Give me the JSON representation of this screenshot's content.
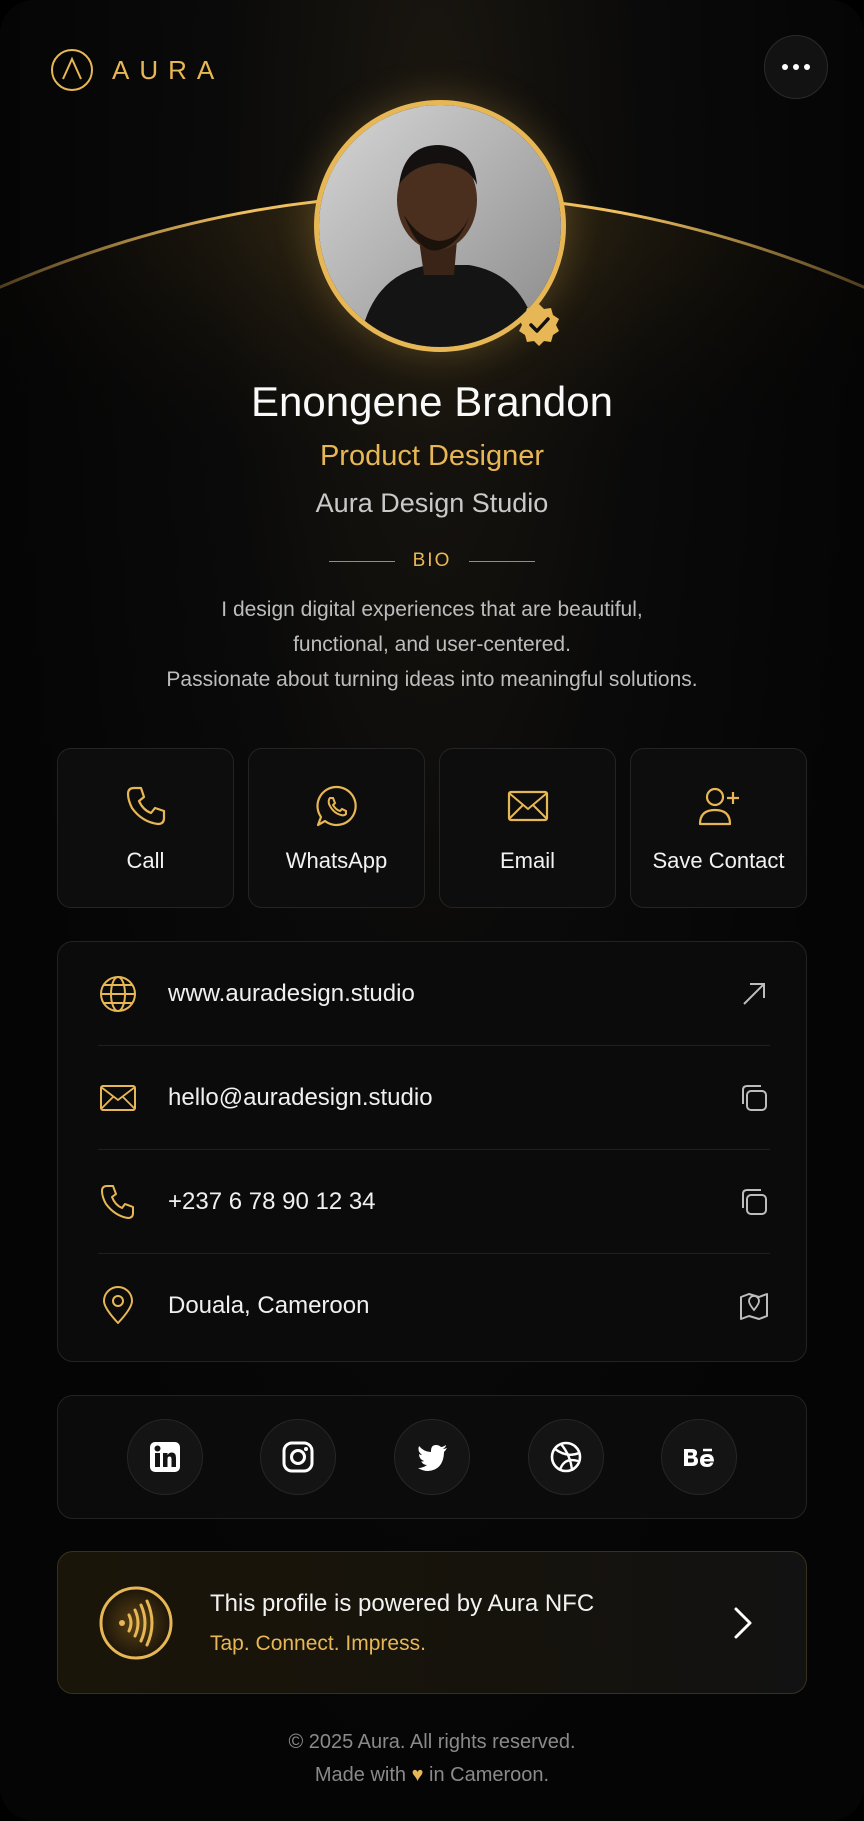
{
  "brand": {
    "name": "AURA",
    "accent": "#e8b755"
  },
  "profile": {
    "name": "Enongene Brandon",
    "role": "Product Designer",
    "company": "Aura Design Studio",
    "bio_title": "BIO",
    "bio_lines": [
      "I design digital experiences that are beautiful,",
      "functional, and user-centered.",
      "Passionate about turning ideas into meaningful solutions."
    ]
  },
  "actions": [
    {
      "label": "Call",
      "icon": "phone-icon"
    },
    {
      "label": "WhatsApp",
      "icon": "whatsapp-icon"
    },
    {
      "label": "Email",
      "icon": "mail-icon"
    },
    {
      "label": "Save Contact",
      "icon": "add-user-icon"
    }
  ],
  "contacts": [
    {
      "value": "www.auradesign.studio",
      "icon": "globe-icon",
      "action": "external-link-icon"
    },
    {
      "value": "hello@auradesign.studio",
      "icon": "mail-icon",
      "action": "copy-icon"
    },
    {
      "value": "+237 6 78 90 12 34",
      "icon": "phone-icon",
      "action": "copy-icon"
    },
    {
      "value": "Douala, Cameroon",
      "icon": "location-pin-icon",
      "action": "map-icon"
    }
  ],
  "socials": [
    "linkedin-icon",
    "instagram-icon",
    "twitter-icon",
    "dribbble-icon",
    "behance-icon"
  ],
  "nfc": {
    "title": "This profile is powered by Aura NFC",
    "subtitle": "Tap. Connect. Impress."
  },
  "footer": {
    "copyright": "© 2025 Aura. All rights reserved.",
    "made_prefix": "Made with",
    "heart": "♥",
    "made_suffix": "in Cameroon."
  }
}
